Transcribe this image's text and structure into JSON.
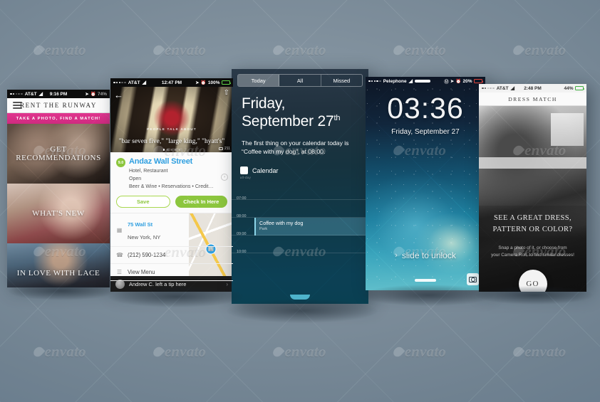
{
  "scene": {
    "title": "iPhone app screens mockup — five angled device screenshots",
    "background_color": "#7e8e9b",
    "watermark_text": "envato"
  },
  "phones": [
    {
      "id": "rent-the-runway",
      "status_bar": {
        "carrier": "AT&T",
        "time": "9:16 PM",
        "battery": "74%"
      },
      "nav_title": "RENT THE RUNWAY",
      "promo_banner": "TAKE A PHOTO, FIND A MATCH!",
      "tiles": [
        {
          "caption": "GET RECOMMENDATIONS"
        },
        {
          "caption": "WHAT'S NEW"
        },
        {
          "caption": "IN LOVE WITH LACE"
        }
      ]
    },
    {
      "id": "foursquare-venue",
      "status_bar": {
        "carrier": "AT&T",
        "time": "12:47 PM",
        "battery": "100%"
      },
      "hero": {
        "people_talk_about": "PEOPLE TALK ABOUT",
        "quotes": "\"bar seven five,\"  \"large king,\"  \"hyatt's\"",
        "photo_count": "211"
      },
      "venue": {
        "score": "9.0",
        "name": "Andaz Wall Street",
        "categories": "Hotel, Restaurant",
        "status": "Open",
        "amenities": "Beer & Wine • Reservations • Credit…"
      },
      "buttons": {
        "save": "Save",
        "check_in": "Check In Here"
      },
      "info_rows": [
        {
          "line1": "75 Wall St",
          "line2": "New York, NY"
        },
        {
          "line1": "(212) 590-1234",
          "line2": ""
        },
        {
          "line1": "View Menu",
          "line2": ""
        }
      ],
      "tip_bar": "Andrew C. left a tip here"
    },
    {
      "id": "notification-center",
      "tabs": [
        {
          "label": "Today",
          "active": true
        },
        {
          "label": "All",
          "active": false
        },
        {
          "label": "Missed",
          "active": false
        }
      ],
      "date_line1": "Friday,",
      "date_line2": "September 27",
      "date_suffix": "th",
      "summary": "The first thing on your calendar today is “Coffee with my dog”, at 08:00.",
      "calendar_label": "Calendar",
      "all_day_label": "all-day",
      "timeline": [
        {
          "time": "07:00"
        },
        {
          "time": "08:00"
        },
        {
          "time": "09:00"
        },
        {
          "time": "10:00"
        }
      ],
      "event": {
        "title": "Coffee with my dog",
        "location": "Park"
      }
    },
    {
      "id": "lock-screen",
      "status_bar": {
        "carrier": "Pelephone",
        "battery": "20%"
      },
      "time": "03:36",
      "date": "Friday, September 27",
      "slide_to_unlock": "slide to unlock",
      "slide_arrow": "›"
    },
    {
      "id": "dress-match",
      "status_bar": {
        "carrier": "AT&T",
        "time": "2:48 PM",
        "battery": "44%"
      },
      "nav_title": "DRESS MATCH",
      "headline_line1": "SEE A GREAT DRESS,",
      "headline_line2": "PATTERN OR COLOR?",
      "subtext_line1": "Snap a photo of it, or choose from",
      "subtext_line2": "your Camera Roll, to find similar dresses!",
      "cta": "GO"
    }
  ]
}
